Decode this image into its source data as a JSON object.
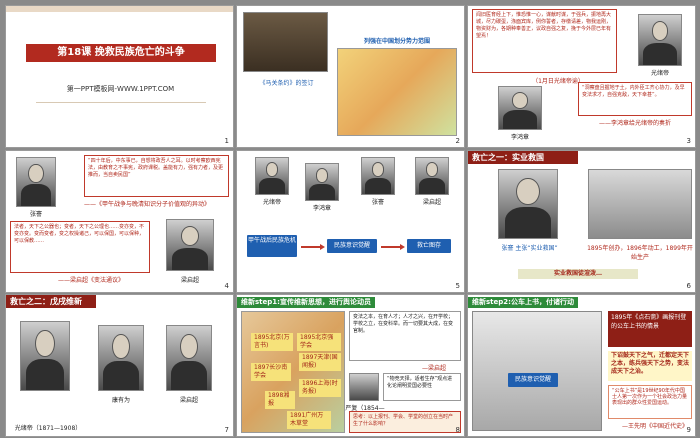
{
  "colors": {
    "accent_red": "#c0392b",
    "dark_red": "#8e1f16",
    "blue": "#1f5fb0",
    "green": "#2e8b3a"
  },
  "slides": {
    "s1": {
      "number": "1",
      "title": "第18课  挽救民族危亡的斗争",
      "subtitle": "第一PPT模板网-WWW.1PPT.COM"
    },
    "s2": {
      "number": "2",
      "photo_caption": "《马关条约》的签订",
      "map_title": "列强在中国划分势力范围"
    },
    "s3": {
      "number": "3",
      "quote": "闻旧医育经上下，惟恐惟一心，谋献时谋，于强兵，振地再大城，尽力碳蛋，涤面宾库，例你誓者，存缴请差，物我运刚，物资财为，各期种奉善正，议政自强之复，挽于今外层已年有望焉！",
      "quote_source": "（1月日光绪帝谕）",
      "emperor_caption": "光绪帝",
      "li_caption": "李鸿章",
      "li_quote": "“洞察盘且握地于土，内外臣工齐心协力，及早变法求才，自强克敌，天下幸甚”。",
      "li_source": "——李鸿章给光绪帝的奏折"
    },
    "s4": {
      "number": "4",
      "quote1": "“四十年后，中东事已，自想将政吾人之耳。以时考察欧西宪法，由教育之不事宪，政府课税。盖能有力，强有力者，及更推而，当自卖民国”",
      "source1": "——《甲午战争与晚清知识分子价值观的异动》",
      "zhang_caption": "张謇",
      "quote2": "法者，天下之公器也；变者，天下之公理也……变亦变，不变亦变。变而变者，变之权操诸己，可以保国，可以保种，可以保教……",
      "source2": "——梁启超《变法通议》",
      "liang_caption": "梁启超"
    },
    "s5": {
      "number": "5",
      "portraits": [
        "光绪帝",
        "李鸿章",
        "张謇",
        "梁启超"
      ],
      "flow": [
        "甲午战后民族危机",
        "民族意识觉醒",
        "救亡图存"
      ]
    },
    "s6": {
      "number": "6",
      "header": "救亡之一：实业救国",
      "photo_caption": "张謇  主张“实业救国”",
      "factory_caption": "1895年创办，1896年动工，1899年开始生产",
      "banner": "实业救国徒渲泼…"
    },
    "s7": {
      "number": "7",
      "header": "救亡之二：戊戌维新",
      "captions": [
        "光绪帝（1871—1908）",
        "康有为",
        "梁启超"
      ]
    },
    "s8": {
      "number": "8",
      "header": "维新step1:宣传维新思想，进行舆论动员",
      "map_labels": [
        "1895北京(万言书)",
        "1895北京强学会",
        "1897长沙南学会",
        "1896上海(时务报)",
        "1897天津(国闻报)",
        "1898湘报",
        "1891广州万木草堂"
      ],
      "quote": "变法之本，在育人才；人才之兴，在开学校；学校之立，在变科举。而一切要其大成，在变官制。",
      "quote_source": "—梁启超",
      "book_caption": "严复（1854—1921）",
      "book_text": "“物竞天择，适者生存”观点进化论阐明爱国必要性",
      "question": "思考：以上报刊、学会、学堂的创立在当时产生了什么影响？"
    },
    "s9": {
      "number": "9",
      "header": "维新step2:公车上书，付诸行动",
      "title_box": "1895年《点石斋》画报刊登的公车上书的情景",
      "quote": "下诏鼓天下之气，迁都定天下之本，练兵强天下之势，变法成天下之治。",
      "source_quote": "“公车上书”是19世纪90年代中国士人第一次作为一个社会政治力量表现出的群众性爱国运动。",
      "source": "—王先明《中国近代史》",
      "button": "民族意识觉醒"
    }
  }
}
